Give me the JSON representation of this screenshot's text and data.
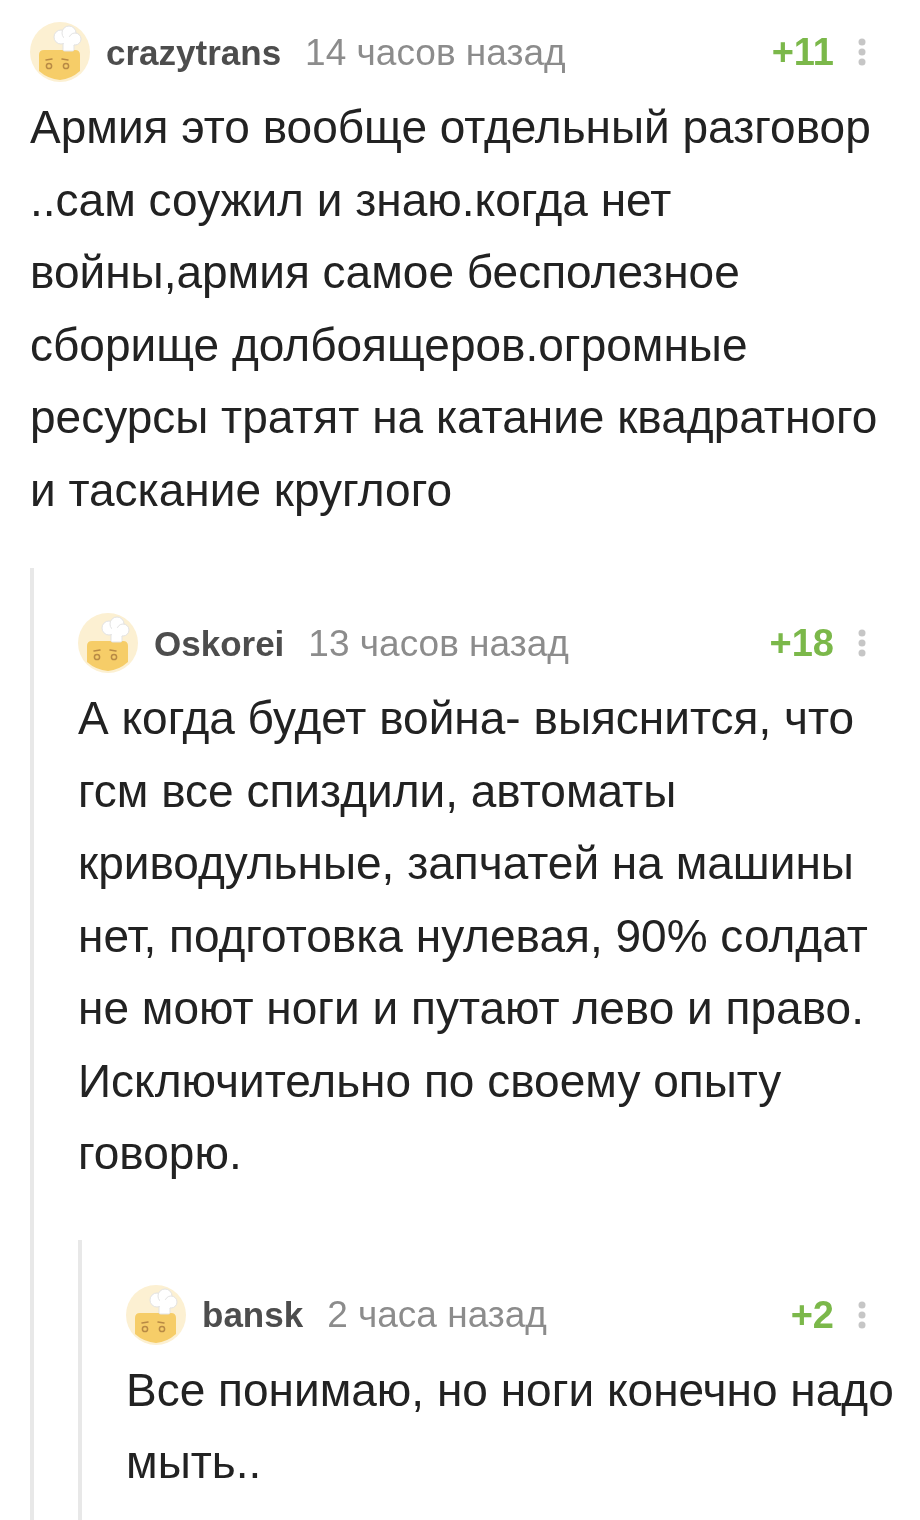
{
  "comments": [
    {
      "author": "crazytrans",
      "time": "14 часов назад",
      "rating": "+11",
      "body": "Армия это вообще отдельный разговор ..сам соужил и знаю.когда нет войны,армия самое бесполезное сборище долбоящеров.огромные ресурсы тратят на катание квадратного и таскание круглого",
      "children": [
        {
          "author": "Oskorei",
          "time": "13 часов назад",
          "rating": "+18",
          "body": "А когда будет война- выяснится, что гсм все спиздили, автоматы криводульные, запчатей на машины нет, подготовка нулевая, 90% солдат не моют ноги и путают лево и право. Исключительно по своему опыту говорю.",
          "children": [
            {
              "author": "bansk",
              "time": "2 часа назад",
              "rating": "+2",
              "body": "Все понимаю, но ноги конечно надо мыть.."
            }
          ]
        }
      ]
    }
  ]
}
